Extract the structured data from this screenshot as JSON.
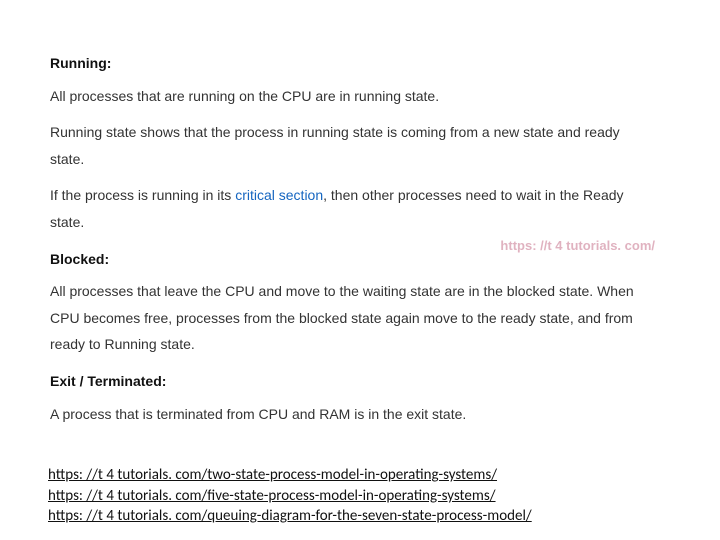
{
  "sections": {
    "running": {
      "title": "Running:",
      "p1": "All processes that are running on the CPU are in running state.",
      "p2": "Running state shows that the process in running state is coming from a new state and ready state.",
      "p3a": "If the process is running in its ",
      "p3_link": "critical section",
      "p3b": ", then other processes need to wait in the Ready state."
    },
    "blocked": {
      "title": "Blocked:",
      "p1": "All processes that leave the CPU and move to the waiting state are in the blocked state. When CPU becomes free, processes from the blocked state again move to the ready state, and from ready to Running state."
    },
    "exit": {
      "title": "Exit / Terminated:",
      "p1": "A process that is terminated from CPU and RAM is in the exit state."
    }
  },
  "watermark": "https: //t 4 tutorials. com/",
  "footer": {
    "link1": "https: //t 4 tutorials. com/two-state-process-model-in-operating-systems/",
    "link2": "https: //t 4 tutorials. com/five-state-process-model-in-operating-systems/",
    "link3": "https: //t 4 tutorials. com/queuing-diagram-for-the-seven-state-process-model/"
  }
}
